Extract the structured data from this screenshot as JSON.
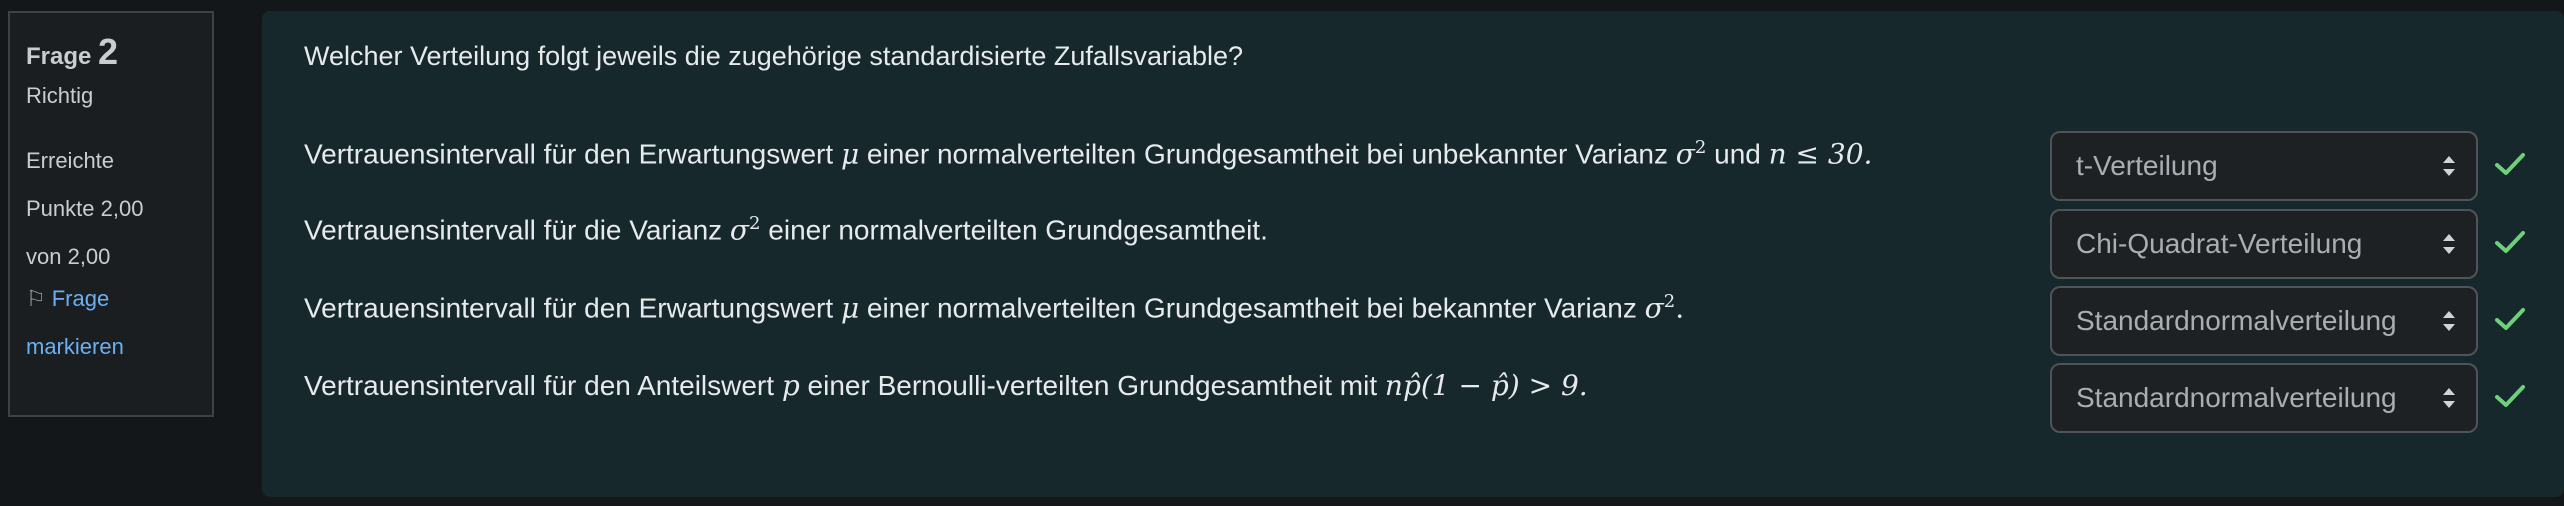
{
  "info": {
    "question_label": "Frage",
    "question_number": "2",
    "state": "Richtig",
    "grade_line1": "Erreichte",
    "grade_line2": "Punkte 2,00",
    "grade_line3": "von 2,00",
    "flag_line1": "Frage",
    "flag_line2": "markieren",
    "flag_icon": "flag-icon"
  },
  "question": {
    "text": "Welcher Verteilung folgt jeweils die zugehörige standardisierte Zufallsvariable?",
    "rows": [
      {
        "before": "Vertrauensintervall für den Erwartungswert",
        "math1": "μ",
        "mid": "einer normalverteilten Grundgesamtheit bei unbekannter Varianz",
        "math2": "σ",
        "exp": "2",
        "and": "und",
        "math3": "n ≤ 30.",
        "answer": "t-Verteilung"
      },
      {
        "before": "Vertrauensintervall für die Varianz",
        "math1": "σ",
        "exp": "2",
        "after": "einer normalverteilten Grundgesamtheit.",
        "answer": "Chi-Quadrat-Verteilung"
      },
      {
        "before": "Vertrauensintervall für den Erwartungswert",
        "math1": "μ",
        "mid": "einer normalverteilten Grundgesamtheit bei bekannter Varianz",
        "math2": "σ",
        "exp": "2",
        "after": ".",
        "answer": "Standardnormalverteilung"
      },
      {
        "before": "Vertrauensintervall für den Anteilswert",
        "math1": "p",
        "mid": "einer Bernoulli-verteilten Grundgesamtheit mit",
        "math2": "np̂(1 − p̂) > 9.",
        "answer": "Standardnormalverteilung"
      }
    ]
  },
  "colors": {
    "check": "#6fcf7b",
    "link": "#6ab0f0",
    "panel": "#16282b"
  }
}
